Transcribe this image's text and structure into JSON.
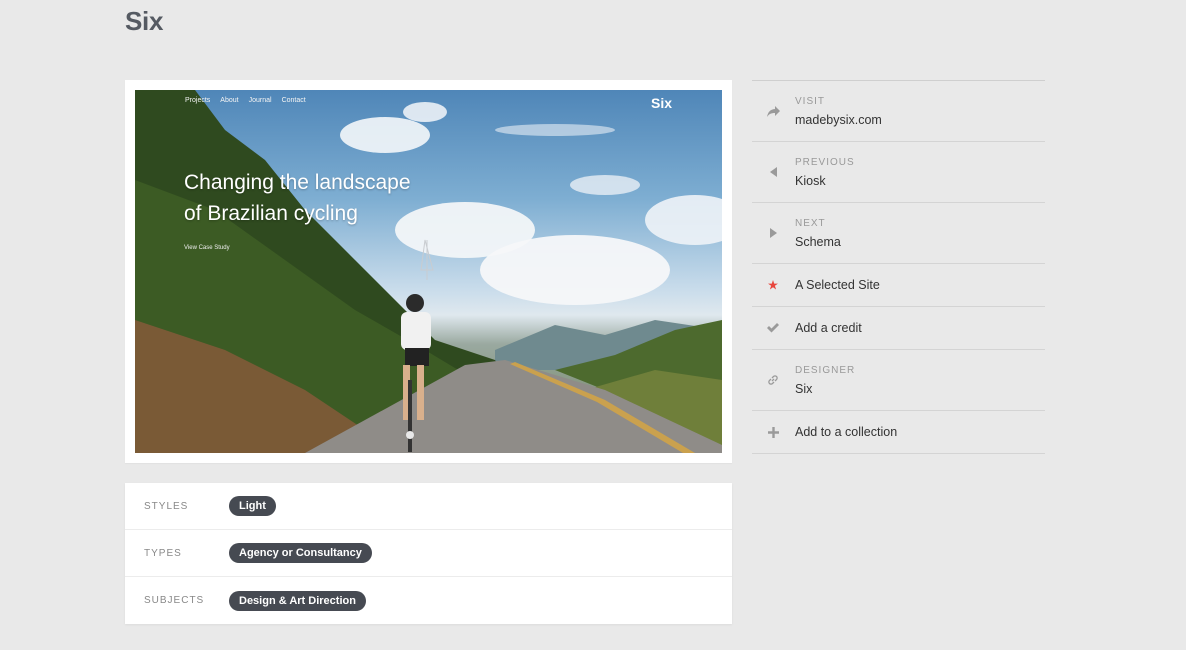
{
  "page": {
    "title": "Six"
  },
  "screenshot": {
    "nav": [
      "Projects",
      "About",
      "Journal",
      "Contact"
    ],
    "brand": "Six",
    "headline": "Changing the landscape\nof Brazilian cycling",
    "cta": "View Case Study"
  },
  "meta": {
    "rows": [
      {
        "label": "STYLES",
        "tag": "Light"
      },
      {
        "label": "TYPES",
        "tag": "Agency or Consultancy"
      },
      {
        "label": "SUBJECTS",
        "tag": "Design & Art Direction"
      }
    ]
  },
  "sidebar": {
    "visit": {
      "kicker": "VISIT",
      "value": "madebysix.com",
      "icon": "share-arrow-icon"
    },
    "previous": {
      "kicker": "PREVIOUS",
      "value": "Kiosk",
      "icon": "triangle-left-icon"
    },
    "next": {
      "kicker": "NEXT",
      "value": "Schema",
      "icon": "triangle-right-icon"
    },
    "selected": {
      "value": "A Selected Site",
      "icon": "star-icon",
      "icon_color": "#e8453c"
    },
    "credit": {
      "value": "Add a credit",
      "icon": "check-icon"
    },
    "designer": {
      "kicker": "DESIGNER",
      "value": "Six",
      "icon": "link-icon"
    },
    "collection": {
      "value": "Add to a collection",
      "icon": "plus-icon"
    }
  }
}
